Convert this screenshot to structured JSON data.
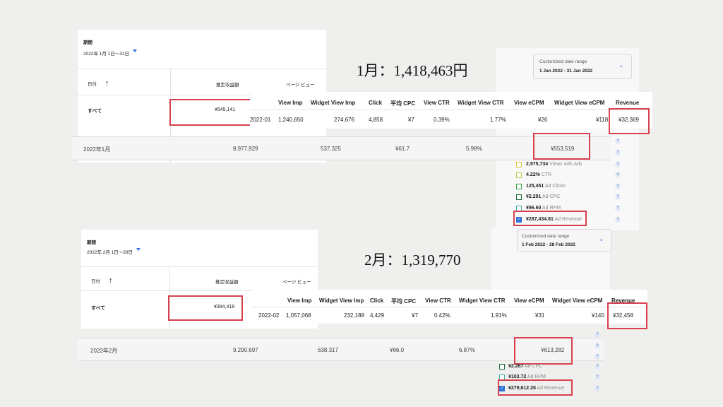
{
  "jan": {
    "total_heading": "1月：1,418,463円",
    "adsense": {
      "period_label": "期間",
      "period_value": "2022年 1月 1日〜31日",
      "col_date": "日付",
      "col_revenue": "推定収益額",
      "col_pageview": "ページ ビュー",
      "row_label": "すべて",
      "row_value": "¥545,141"
    },
    "widget": {
      "headers": [
        "View Imp",
        "Widget View Imp",
        "Click",
        "平均 CPC",
        "View CTR",
        "Widget View CTR",
        "View eCPM",
        "Widget View eCPM",
        "Revenue"
      ],
      "row": [
        "2022-01",
        "1,240,650",
        "274,676",
        "4,858",
        "¥7",
        "0.39%",
        "1.77%",
        "¥26",
        "¥118",
        "¥32,369"
      ]
    },
    "monthly": [
      "2022年1月",
      "8,977,929",
      "537,325",
      "¥61.7",
      "5.98%",
      "¥553,519"
    ],
    "date_range": {
      "label": "Customized date range",
      "value": "1 Jan 2022 - 31 Jan 2022"
    },
    "legend": [
      {
        "value": "2,975,734",
        "label": "Views with Ads"
      },
      {
        "value": "4.22%",
        "label": "CTR"
      },
      {
        "value": "125,451",
        "label": "Ad Clicks"
      },
      {
        "value": "¥2.291",
        "label": "Ad CPC"
      },
      {
        "value": "¥96.60",
        "label": "Ad RPM"
      },
      {
        "value": "¥287,434.81",
        "label": "Ad Revenue"
      }
    ]
  },
  "feb": {
    "total_heading": "2月：1,319,770",
    "adsense": {
      "period_label": "期間",
      "period_value": "2022年 2月 1日〜28日",
      "col_date": "日付",
      "col_revenue": "推定収益額",
      "col_pageview": "ページ ビュー",
      "row_label": "すべて",
      "row_value": "¥394,418"
    },
    "widget": {
      "headers": [
        "View Imp",
        "Widget View Imp",
        "Click",
        "平均 CPC",
        "View CTR",
        "Widget View CTR",
        "View eCPM",
        "Widget View eCPM",
        "Revenue"
      ],
      "row": [
        "2022-02",
        "1,057,068",
        "232,188",
        "4,429",
        "¥7",
        "0.42%",
        "1.91%",
        "¥31",
        "¥140",
        "¥32,458"
      ]
    },
    "monthly": [
      "2022年2月",
      "9,290,697",
      "638,317",
      "¥66.0",
      "6.87%",
      "¥613,282"
    ],
    "date_range": {
      "label": "Customized date range",
      "value": "1 Feb 2022 - 28 Feb 2022"
    },
    "legend": [
      {
        "value": "¥2.267",
        "label": "Ad CPC"
      },
      {
        "value": "¥103.72",
        "label": "Ad RPM"
      },
      {
        "value": "¥279,612.28",
        "label": "Ad Revenue"
      }
    ]
  },
  "colors": {
    "highlight": "#d9414f",
    "accent": "#2f72d8"
  },
  "icons": {
    "sort": "arrow-up-icon",
    "help": "help-circle-icon",
    "dropdown": "chevron-down-icon"
  }
}
